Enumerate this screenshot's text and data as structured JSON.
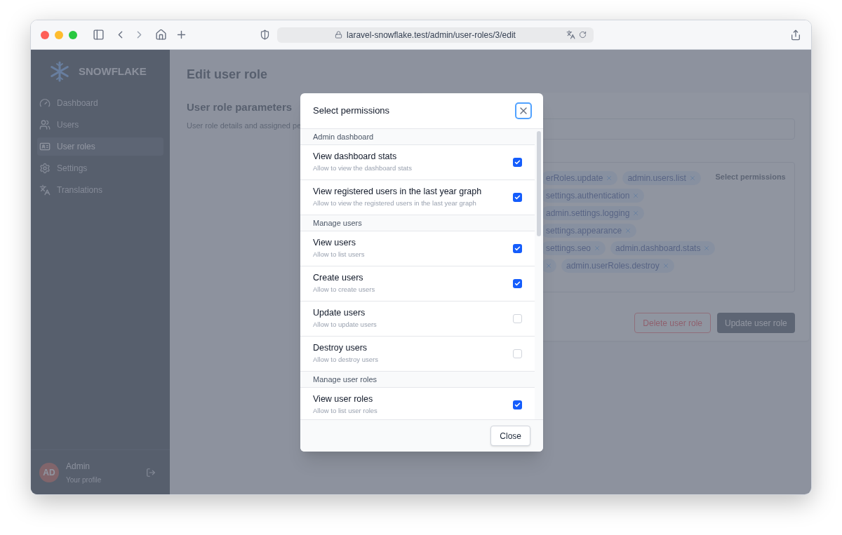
{
  "browser": {
    "url": "laravel-snowflake.test/admin/user-roles/3/edit"
  },
  "sidebar": {
    "brand": "SNOWFLAKE",
    "items": [
      {
        "label": "Dashboard",
        "selected": false
      },
      {
        "label": "Users",
        "selected": false
      },
      {
        "label": "User roles",
        "selected": true
      },
      {
        "label": "Settings",
        "selected": false
      },
      {
        "label": "Translations",
        "selected": false
      }
    ],
    "user": {
      "initials": "AD",
      "name": "Admin",
      "subtitle": "Your profile"
    }
  },
  "page": {
    "title": "Edit user role",
    "section_title": "User role parameters",
    "section_description": "User role details and assigned pe",
    "tag_rows": [
      [
        {
          "label": "erRoles.update"
        },
        {
          "label": "admin.users.list"
        }
      ],
      [
        {
          "label": "settings.authentication"
        }
      ],
      [
        {
          "label": "admin.settings.logging"
        }
      ],
      [
        {
          "label": "settings.appearance"
        }
      ],
      [
        {
          "label": "settings.seo"
        },
        {
          "label": "admin.dashboard.stats"
        }
      ],
      [
        {
          "kind": "cut"
        },
        {
          "label": "admin.userRoles.destroy"
        }
      ]
    ],
    "select_permissions": "Select permissions",
    "buttons": [
      {
        "label": "Delete user role",
        "kind": "danger"
      },
      {
        "label": "Update user role",
        "kind": "primary"
      }
    ]
  },
  "modal": {
    "title": "Select permissions",
    "groups": [
      {
        "title": "Admin dashboard",
        "permissions": [
          {
            "label": "View dashboard stats",
            "description": "Allow to view the dashboard stats",
            "checked": true
          },
          {
            "label": "View registered users in the last year graph",
            "description": "Allow to view the registered users in the last year graph",
            "checked": true
          }
        ]
      },
      {
        "title": "Manage users",
        "permissions": [
          {
            "label": "View users",
            "description": "Allow to list users",
            "checked": true
          },
          {
            "label": "Create users",
            "description": "Allow to create users",
            "checked": true
          },
          {
            "label": "Update users",
            "description": "Allow to update users",
            "checked": false
          },
          {
            "label": "Destroy users",
            "description": "Allow to destroy users",
            "checked": false
          }
        ]
      },
      {
        "title": "Manage user roles",
        "permissions": [
          {
            "label": "View user roles",
            "description": "Allow to list user roles",
            "checked": true
          }
        ]
      }
    ],
    "close_label": "Close"
  }
}
